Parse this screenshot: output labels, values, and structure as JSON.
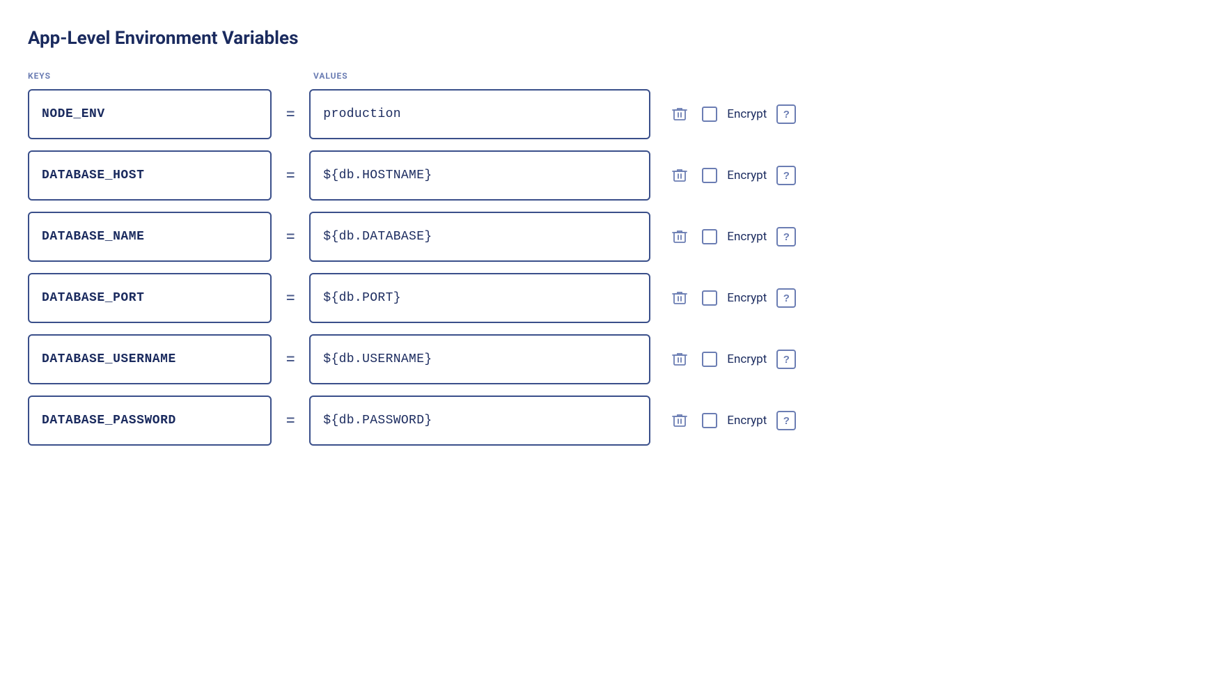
{
  "page": {
    "title": "App-Level Environment Variables"
  },
  "columns": {
    "keys_label": "KEYS",
    "values_label": "VALUES"
  },
  "rows": [
    {
      "id": 1,
      "key": "NODE_ENV",
      "value": "production",
      "encrypt": false
    },
    {
      "id": 2,
      "key": "DATABASE_HOST",
      "value": "${db.HOSTNAME}",
      "encrypt": false
    },
    {
      "id": 3,
      "key": "DATABASE_NAME",
      "value": "${db.DATABASE}",
      "encrypt": false
    },
    {
      "id": 4,
      "key": "DATABASE_PORT",
      "value": "${db.PORT}",
      "encrypt": false
    },
    {
      "id": 5,
      "key": "DATABASE_USERNAME",
      "value": "${db.USERNAME}",
      "encrypt": false
    },
    {
      "id": 6,
      "key": "DATABASE_PASSWORD",
      "value": "${db.PASSWORD}",
      "encrypt": false
    }
  ],
  "labels": {
    "encrypt": "Encrypt",
    "help": "?",
    "equals": "="
  }
}
